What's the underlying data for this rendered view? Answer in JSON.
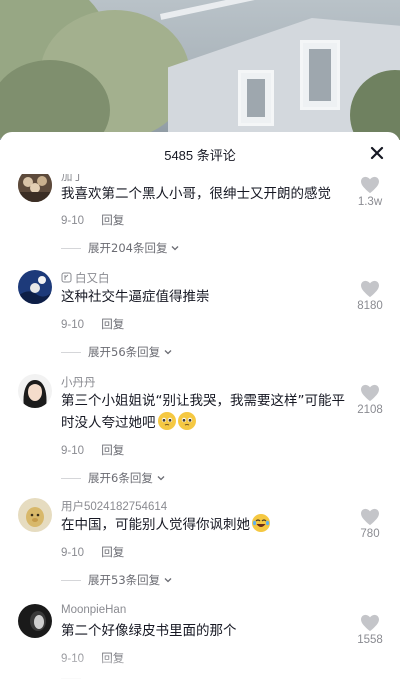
{
  "header": {
    "title": "5485 条评论"
  },
  "comments": [
    {
      "username": "加丁",
      "text": "我喜欢第二个黑人小哥，很绅士又开朗的感觉",
      "date": "9-10",
      "reply": "回复",
      "likes": "1.3w",
      "expand": "展开204条回复",
      "avatar": "avatar-crowd",
      "emoji": ""
    },
    {
      "username": "白又白",
      "text": "这种社交牛逼症值得推崇",
      "date": "9-10",
      "reply": "回复",
      "likes": "8180",
      "expand": "展开56条回复",
      "avatar": "avatar-night-sky",
      "emoji": ""
    },
    {
      "username": "小丹丹",
      "text": "第三个小姐姐说“别让我哭，我需要这样”可能平时没人夸过她吧",
      "date": "9-10",
      "reply": "回复",
      "likes": "2108",
      "expand": "展开6条回复",
      "avatar": "avatar-girl",
      "emoji": "pleading-face-emoji ×2"
    },
    {
      "username": "用户5024182754614",
      "text": "在中国，可能别人觉得你讽刺她",
      "date": "9-10",
      "reply": "回复",
      "likes": "780",
      "expand": "展开53条回复",
      "avatar": "avatar-default",
      "emoji": "laughing-tears-emoji"
    },
    {
      "username": "MoonpieHan",
      "text": "第二个好像绿皮书里面的那个",
      "date": "9-10",
      "reply": "回复",
      "likes": "1558",
      "expand": "",
      "avatar": "avatar-dark",
      "emoji": ""
    }
  ],
  "colors": {
    "text_primary": "#161823",
    "text_secondary": "#8a8b91",
    "heart": "#c4c5c9"
  }
}
